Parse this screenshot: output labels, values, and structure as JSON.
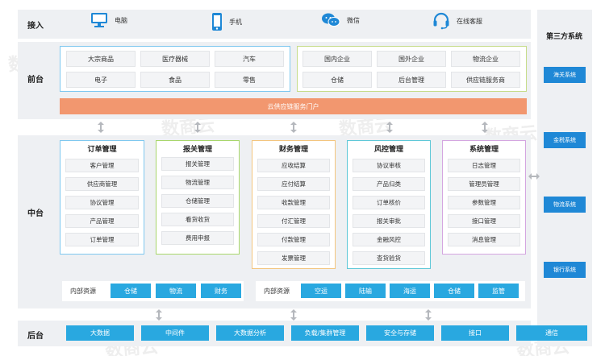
{
  "access": {
    "label": "接入",
    "items": [
      {
        "label": "电脑",
        "icon": "monitor-icon"
      },
      {
        "label": "手机",
        "icon": "phone-icon"
      },
      {
        "label": "微信",
        "icon": "wechat-icon"
      },
      {
        "label": "在线客服",
        "icon": "headset-icon"
      }
    ]
  },
  "third_party": {
    "title": "第三方系统",
    "items": [
      "海关系统",
      "金税系统",
      "物流系统",
      "银行系统"
    ]
  },
  "front": {
    "label": "前台",
    "left_cells": [
      "大宗商品",
      "医疗器械",
      "汽车",
      "电子",
      "食品",
      "零售"
    ],
    "right_cells": [
      "国内企业",
      "国外企业",
      "物流企业",
      "仓储",
      "后台管理",
      "供应链服务商"
    ],
    "portal": "云供应链服务门户"
  },
  "middle": {
    "label": "中台",
    "modules": [
      {
        "title": "订单管理",
        "items": [
          "客户管理",
          "供应商管理",
          "协议管理",
          "产品管理",
          "订单管理"
        ]
      },
      {
        "title": "报关管理",
        "items": [
          "报关管理",
          "物流管理",
          "仓储管理",
          "看货收货",
          "费用申报"
        ]
      },
      {
        "title": "财务管理",
        "items": [
          "应收结算",
          "应付结算",
          "收款管理",
          "付汇管理",
          "付款管理",
          "发票管理"
        ]
      },
      {
        "title": "风控管理",
        "items": [
          "协议审核",
          "产品归类",
          "订单核价",
          "报关审批",
          "金融风控",
          "查货验货"
        ]
      },
      {
        "title": "系统管理",
        "items": [
          "日志管理",
          "管理员管理",
          "参数管理",
          "接口管理",
          "消息管理"
        ]
      }
    ],
    "internal_left": {
      "label": "内部资源",
      "buttons": [
        "仓储",
        "物流",
        "财务"
      ]
    },
    "internal_right": {
      "label": "内部资源",
      "buttons": [
        "空运",
        "陆输",
        "海运",
        "仓储",
        "监管"
      ]
    }
  },
  "back": {
    "label": "后台",
    "buttons": [
      "大数据",
      "中间件",
      "大数据分析",
      "负载/集群管理",
      "安全与存储",
      "接口",
      "通信"
    ]
  },
  "watermark": "数商云",
  "colors": {
    "accent_blue": "#29a8e0",
    "dark_blue": "#1f88d6",
    "portal_orange": "#f2976f",
    "front_left_border": "#7fc8ef",
    "front_right_border": "#c6dc8a",
    "module_borders": [
      "#7fc8ef",
      "#a8d66b",
      "#f3c57e",
      "#5ec8d8",
      "#d4a6e0"
    ]
  }
}
